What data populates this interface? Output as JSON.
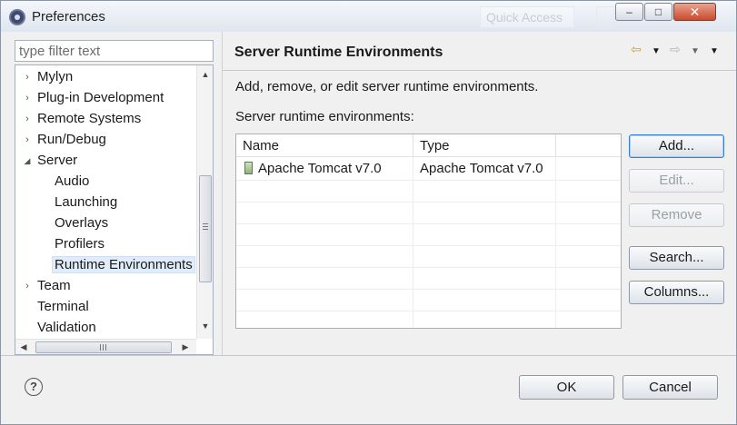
{
  "window": {
    "title": "Preferences",
    "quick_access": "Quick Access",
    "minimize_glyph": "‒",
    "maximize_glyph": "□",
    "close_glyph": "✕"
  },
  "filter": {
    "placeholder": "type filter text",
    "value": ""
  },
  "tree": {
    "items": [
      {
        "label": "Mylyn",
        "expanded": false,
        "level": 0
      },
      {
        "label": "Plug-in Development",
        "expanded": false,
        "level": 0
      },
      {
        "label": "Remote Systems",
        "expanded": false,
        "level": 0
      },
      {
        "label": "Run/Debug",
        "expanded": false,
        "level": 0
      },
      {
        "label": "Server",
        "expanded": true,
        "level": 0
      },
      {
        "label": "Audio",
        "level": 1
      },
      {
        "label": "Launching",
        "level": 1
      },
      {
        "label": "Overlays",
        "level": 1
      },
      {
        "label": "Profilers",
        "level": 1
      },
      {
        "label": "Runtime Environments",
        "level": 1,
        "selected": true
      },
      {
        "label": "Team",
        "expanded": false,
        "level": 0
      },
      {
        "label": "Terminal",
        "level": 0
      },
      {
        "label": "Validation",
        "level": 0
      }
    ],
    "collapsed_glyph": "›",
    "expanded_glyph": "◢",
    "scroll_up_glyph": "▲",
    "scroll_down_glyph": "▼",
    "scroll_left_glyph": "◀",
    "scroll_right_glyph": "▶"
  },
  "page": {
    "title": "Server Runtime Environments",
    "description": "Add, remove, or edit server runtime environments.",
    "list_label": "Server runtime environments:",
    "nav_back_glyph": "⇦",
    "nav_forward_glyph": "⇨",
    "nav_menu_glyph": "▼"
  },
  "table": {
    "columns": [
      "Name",
      "Type"
    ],
    "rows": [
      {
        "name": "Apache Tomcat v7.0",
        "type": "Apache Tomcat v7.0",
        "icon": "server-icon"
      }
    ]
  },
  "buttons": {
    "add": "Add...",
    "edit": "Edit...",
    "remove": "Remove",
    "search": "Search...",
    "columns": "Columns..."
  },
  "footer": {
    "help_glyph": "?",
    "ok": "OK",
    "cancel": "Cancel"
  },
  "colors": {
    "selection": "#e1ecfa",
    "primary_button_border": "#3b7fc8",
    "nav_back": "#d9a400",
    "close_button": "#c94a2e"
  }
}
